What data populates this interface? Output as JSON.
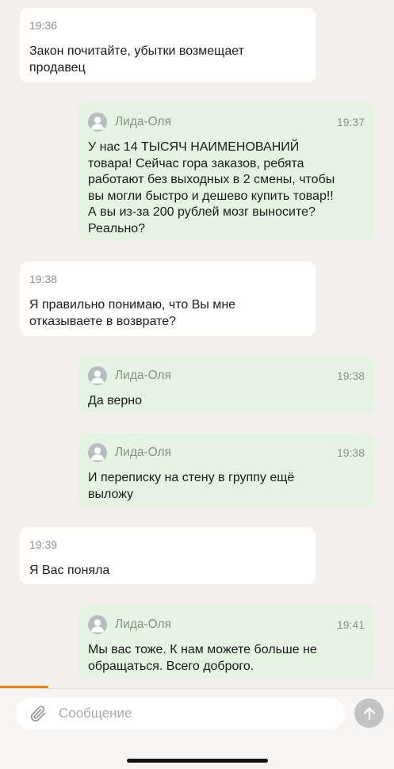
{
  "chat": {
    "messages": [
      {
        "direction": "in",
        "time": "19:36",
        "text": "Закон почитайте, убытки возмещает\nпродавец"
      },
      {
        "direction": "out",
        "sender": "Лида-Оля",
        "time": "19:37",
        "text": "У нас 14 ТЫСЯЧ НАИМЕНОВАНИЙ\nтовара! Сейчас гора заказов, ребята\nработают без выходных в 2 смены, чтобы\nвы могли быстро и дешево купить товар!!\nА вы из-за 200 рублей мозг выносите?\nРеально?"
      },
      {
        "direction": "in",
        "time": "19:38",
        "text": "Я правильно понимаю, что Вы мне\nотказываете в возврате?"
      },
      {
        "direction": "out",
        "sender": "Лида-Оля",
        "time": "19:38",
        "text": "Да верно"
      },
      {
        "direction": "out",
        "sender": "Лида-Оля",
        "time": "19:38",
        "text": "И переписку на стену в группу ещё\nвыложу"
      },
      {
        "direction": "in",
        "time": "19:39",
        "text": "Я Вас поняла"
      },
      {
        "direction": "out",
        "sender": "Лида-Оля",
        "time": "19:41",
        "text": "Мы вас тоже. К нам можете больше не\nобращаться. Всего доброго."
      }
    ]
  },
  "composer": {
    "placeholder": "Сообщение",
    "attach_icon": "paperclip-icon",
    "send_icon": "arrow-up-icon"
  },
  "colors": {
    "background": "#f2efec",
    "incoming_bubble": "#ffffff",
    "outgoing_bubble": "#e5f3e3",
    "accent": "#ee8208",
    "meta_text": "#8e8e8e"
  }
}
